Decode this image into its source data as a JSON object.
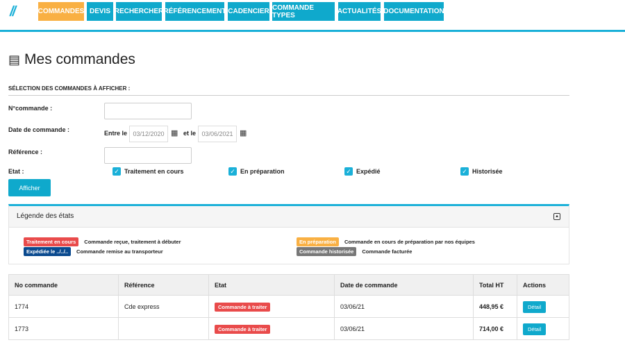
{
  "nav": {
    "logo": "//",
    "items": [
      "COMMANDES",
      "DEVIS",
      "RECHERCHER",
      "RÉFÉRENCEMENT",
      "CADENCIER",
      "COMMANDE TYPES",
      "ACTUALITÉS",
      "DOCUMENTATION"
    ]
  },
  "page": {
    "title": "Mes commandes",
    "section": "SÉLECTION DES COMMANDES À AFFICHER :"
  },
  "form": {
    "num_label": "N°commande :",
    "num_value": "",
    "date_label": "Date de commande :",
    "between": "Entre le",
    "date_from": "03/12/2020",
    "and": "et le",
    "date_to": "03/06/2021",
    "ref_label": "Référence :",
    "ref_value": "",
    "etat_label": "Etat :",
    "states": [
      "Traitement en cours",
      "En préparation",
      "Expédié",
      "Historisée"
    ],
    "submit": "Afficher"
  },
  "legend": {
    "title": "Légende des états",
    "items": [
      {
        "badge": "Traitement en cours",
        "text": "Commande reçue, traitement à débuter",
        "color": "#e94b4b"
      },
      {
        "badge": "En préparation",
        "text": "Commande en cours de préparation par nos équipes",
        "color": "#f9b043"
      },
      {
        "badge": "Expédiée le ../../..",
        "text": "Commande remise au transporteur",
        "color": "#0a4a8f"
      },
      {
        "badge": "Commande historisée",
        "text": "Commande facturée",
        "color": "#777777"
      }
    ]
  },
  "table": {
    "headers": [
      "No commande",
      "Référence",
      "Etat",
      "Date de commande",
      "Total HT",
      "Actions"
    ],
    "rows": [
      {
        "num": "1774",
        "ref": "Cde express",
        "etat": "Commande à traiter",
        "date": "03/06/21",
        "total": "448,95 €",
        "action": "Détail"
      },
      {
        "num": "1773",
        "ref": "",
        "etat": "Commande à traiter",
        "date": "03/06/21",
        "total": "714,00 €",
        "action": "Détail"
      }
    ]
  }
}
